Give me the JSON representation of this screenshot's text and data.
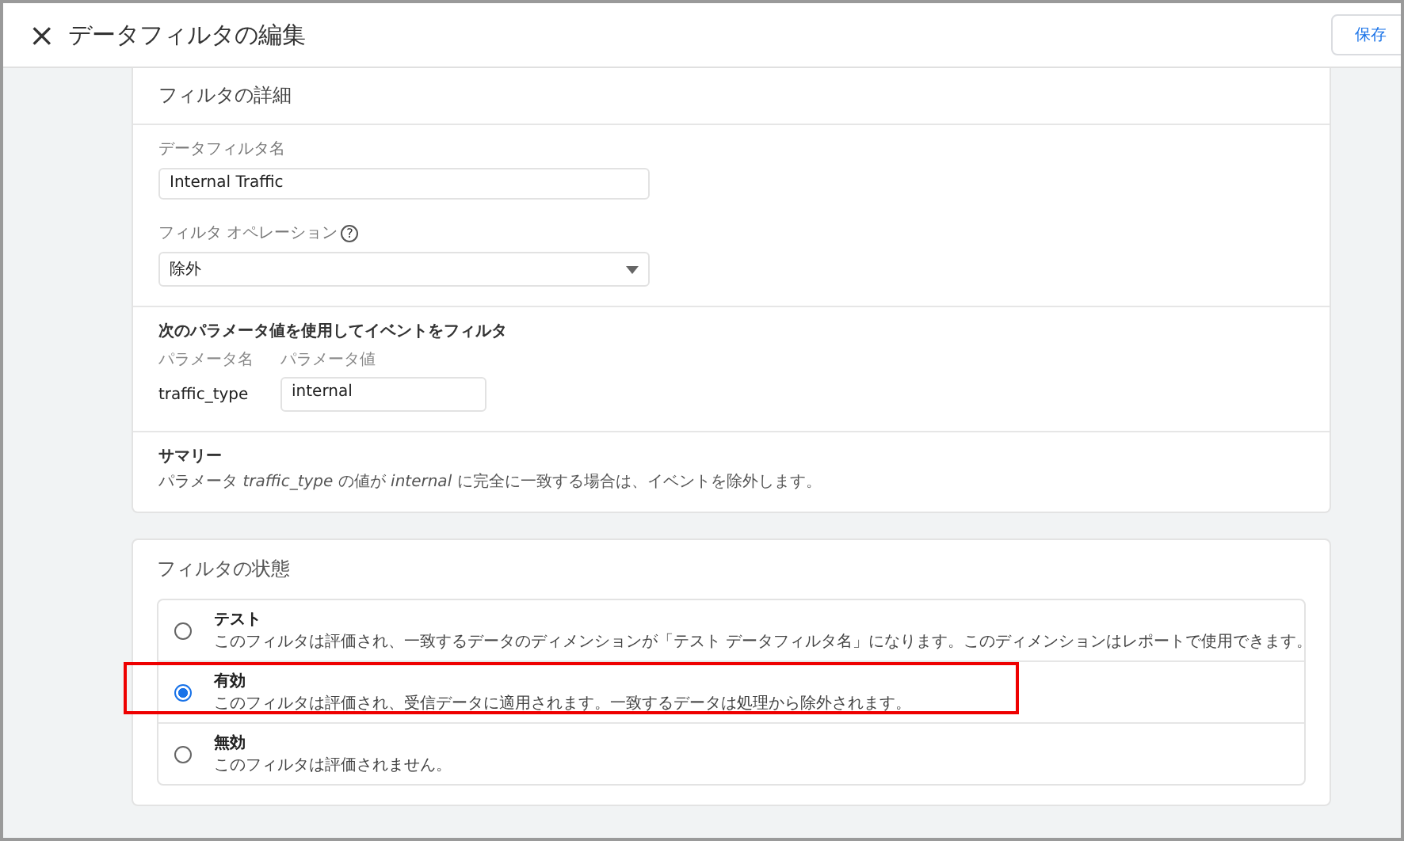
{
  "header": {
    "close": "×",
    "title": "データフィルタの編集",
    "save_button": "保存"
  },
  "details": {
    "heading": "フィルタの詳細",
    "name_label": "データフィルタ名",
    "name_value": "Internal Traffic",
    "operation_label": "フィルタ オペレーション",
    "operation_help": "?",
    "operation_value": "除外"
  },
  "parameters": {
    "heading": "次のパラメータ値を使用してイベントをフィルタ",
    "name_header": "パラメータ名",
    "value_header": "パラメータ値",
    "name": "traffic_type",
    "value": "internal"
  },
  "summary": {
    "heading": "サマリー",
    "text": "パラメータ *traffic_type* の値が *internal* に完全に一致する場合は、イベントを除外します。"
  },
  "status": {
    "heading": "フィルタの状態",
    "options": [
      {
        "title": "テスト",
        "description": "このフィルタは評価され、一致するデータのディメンションが「テスト データフィルタ名」になります。このディメンションはレポートで使用できます。",
        "selected": false,
        "highlighted": false
      },
      {
        "title": "有効",
        "description": "このフィルタは評価され、受信データに適用されます。一致するデータは処理から除外されます。",
        "selected": true,
        "highlighted": true
      },
      {
        "title": "無効",
        "description": "このフィルタは評価されません。",
        "selected": false,
        "highlighted": false
      }
    ]
  }
}
